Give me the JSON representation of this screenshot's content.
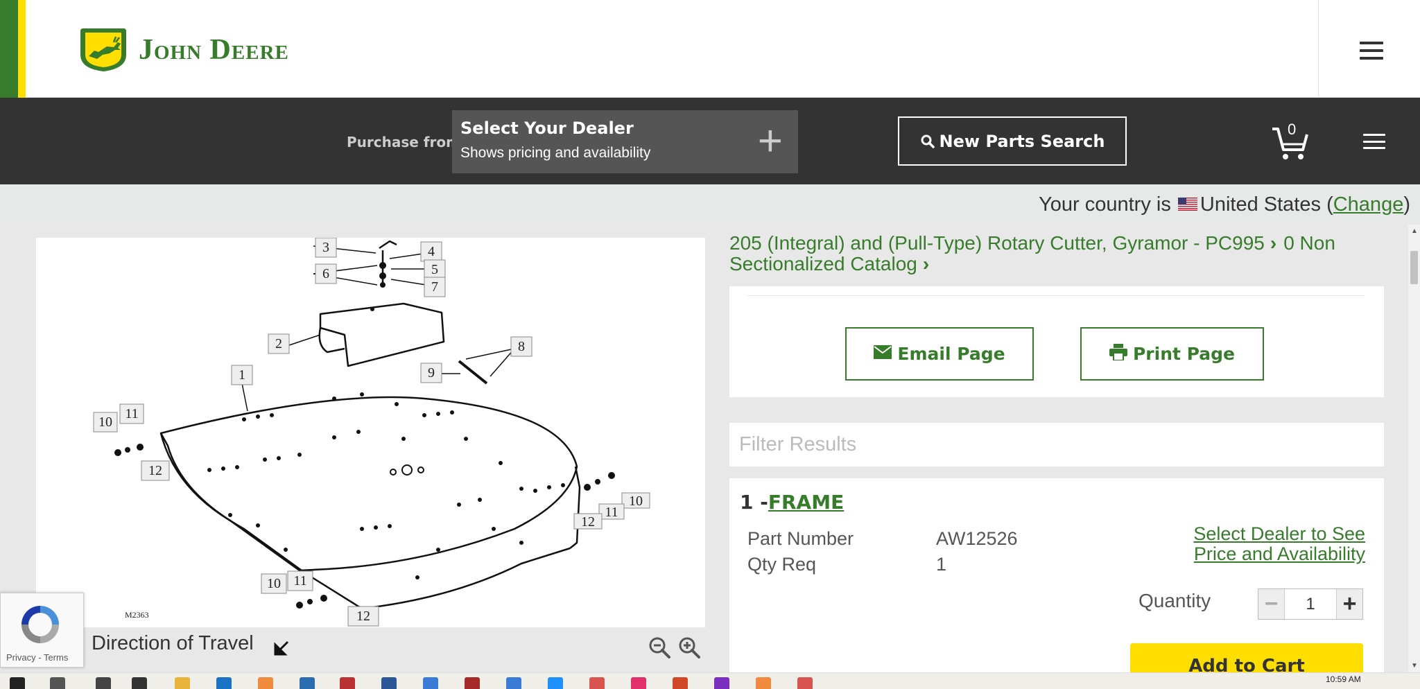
{
  "header": {
    "brand_name": "John Deere"
  },
  "navbar": {
    "purchase_label": "Purchase from",
    "dealer_title": "Select Your Dealer",
    "dealer_subtitle": "Shows pricing and availability",
    "new_parts_search": "New Parts Search",
    "cart_count": "0"
  },
  "country": {
    "prefix": "Your country is",
    "name": "United States",
    "change_label": "Change",
    "open_paren": "(",
    "close_paren": ")"
  },
  "breadcrumb": {
    "item1": "205 (Integral) and (Pull-Type) Rotary Cutter, Gyramor - PC995",
    "item2": "0 Non Sectionalized Catalog"
  },
  "diagram": {
    "caption": "Direction of Travel",
    "callouts": [
      "1",
      "2",
      "3",
      "4",
      "5",
      "6",
      "7",
      "8",
      "9",
      "10",
      "11",
      "12"
    ],
    "ref_code": "M2363"
  },
  "actions": {
    "email_label": "Email Page",
    "print_label": "Print Page"
  },
  "filter": {
    "placeholder": "Filter Results"
  },
  "part": {
    "index": "1 -",
    "name": "FRAME",
    "part_number_label": "Part Number",
    "part_number": "AW12526",
    "qty_req_label": "Qty Req",
    "qty_req": "1",
    "dealer_link": "Select Dealer to See Price and Availability",
    "quantity_label": "Quantity",
    "quantity_value": "1",
    "add_to_cart": "Add to Cart"
  },
  "recaptcha": {
    "privacy": "Privacy",
    "separator": " - ",
    "terms": "Terms"
  },
  "taskbar": {
    "time": "10:59 AM"
  },
  "colors": {
    "brand_green": "#367c2b",
    "brand_yellow": "#ffde00",
    "nav_dark": "#333333"
  }
}
